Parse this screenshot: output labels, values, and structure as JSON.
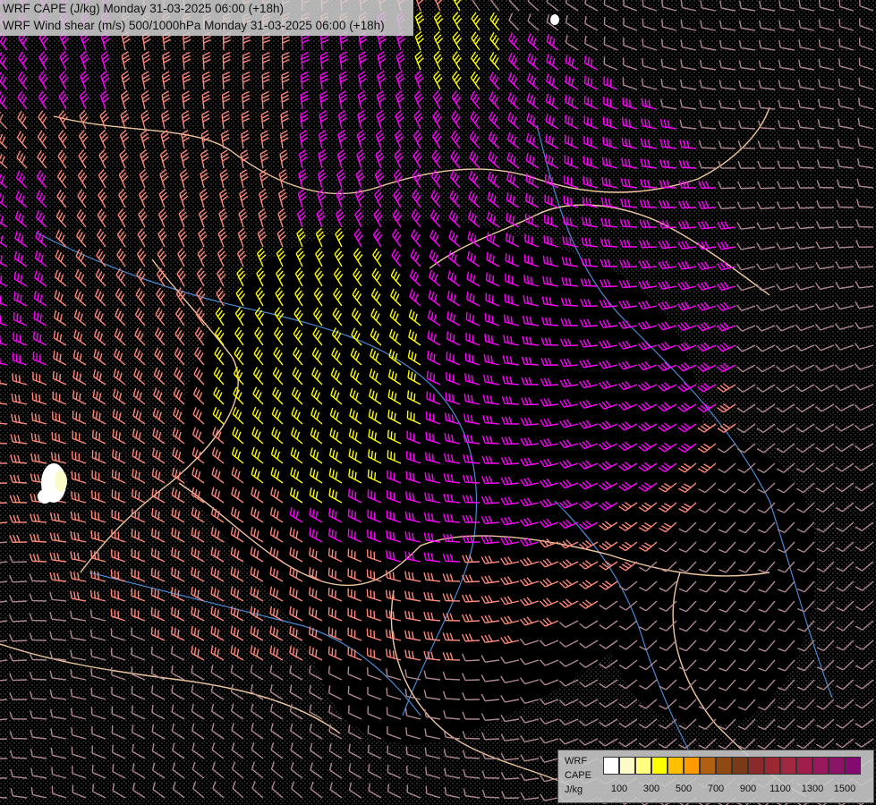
{
  "title": {
    "line1": "WRF CAPE (J/kg) Monday 31-03-2025 06:00 (+18h)",
    "line2": "WRF Wind shear (m/s) 500/1000hPa Monday 31-03-2025 06:00 (+18h)"
  },
  "legend": {
    "line1": "WRF",
    "line2": "CAPE",
    "line3": "J/kg",
    "colors": [
      "#ffffff",
      "#fbfbc8",
      "#ffff80",
      "#ffff00",
      "#ffc000",
      "#ff9a00",
      "#b06010",
      "#8f4a14",
      "#7a3a18",
      "#8a2a2a",
      "#9a2832",
      "#a02840",
      "#a01e4c",
      "#981a5c",
      "#8c1466",
      "#820a70"
    ],
    "tick_labels": [
      "100",
      "300",
      "500",
      "700",
      "900",
      "1100",
      "1300",
      "1500"
    ]
  },
  "colors": {
    "background": "#000000",
    "shear_low": "#d88070",
    "shear_med": "#ff8878",
    "shear_high": "#ff00ff",
    "shear_very_high": "#ffff00",
    "shear_weak": "#b08890",
    "borders": "#f0c8a0",
    "rivers": "#4a88d0",
    "terrain": "#808080"
  }
}
